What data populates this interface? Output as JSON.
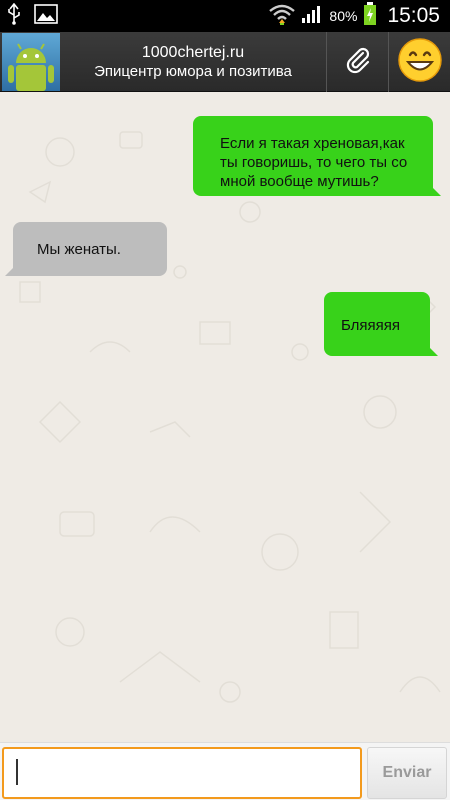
{
  "status_bar": {
    "battery_percent": "80%",
    "time": "15:05",
    "icons": [
      "usb-icon",
      "image-icon",
      "wifi-icon",
      "signal-icon",
      "battery-charging-icon"
    ]
  },
  "header": {
    "title": "1000chertej.ru",
    "subtitle": "Эпицентр юмора и позитива",
    "avatar_icon": "android-avatar-icon",
    "attach_icon": "paperclip-icon",
    "emoji_icon": "smiley-icon"
  },
  "messages": [
    {
      "direction": "out",
      "lines": [
        "Если я такая хреновая,как",
        "ты говоришь, то чего ты со",
        "мной вообще мутишь?"
      ]
    },
    {
      "direction": "in",
      "lines": [
        "Мы женаты."
      ]
    },
    {
      "direction": "out",
      "lines": [
        "Бляяяяя"
      ]
    }
  ],
  "composer": {
    "input_value": "",
    "input_placeholder": "",
    "send_label": "Enviar"
  },
  "colors": {
    "outgoing_bubble": "#38d21a",
    "incoming_bubble": "#bdbdbd",
    "input_focus_border": "#f39a1d",
    "header_bg": "#333333"
  }
}
